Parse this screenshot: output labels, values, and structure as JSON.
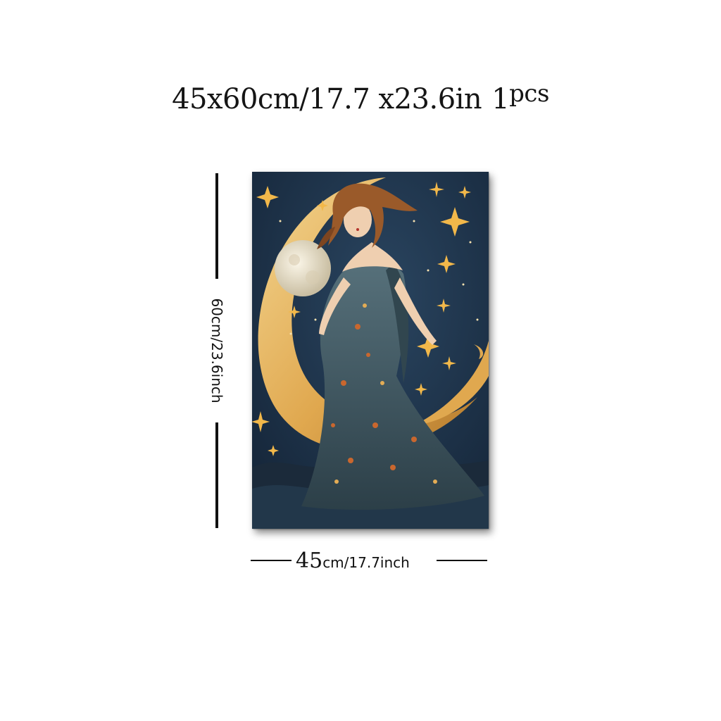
{
  "title": {
    "size": "45x60cm/17.7 x23.6in",
    "quantity": "1",
    "unit": "pcs"
  },
  "dimensions": {
    "height_label": "60cm/23.6inch",
    "width_number": "45",
    "width_rest": "cm/17.7inch"
  },
  "artwork": {
    "colors": {
      "sky": "#1c2f45",
      "moon": "#e3ac55",
      "full_moon": "#f0e8d4",
      "gown": "#3e5660",
      "hair": "#9a5a2a",
      "stars": "#f2b84a"
    }
  }
}
